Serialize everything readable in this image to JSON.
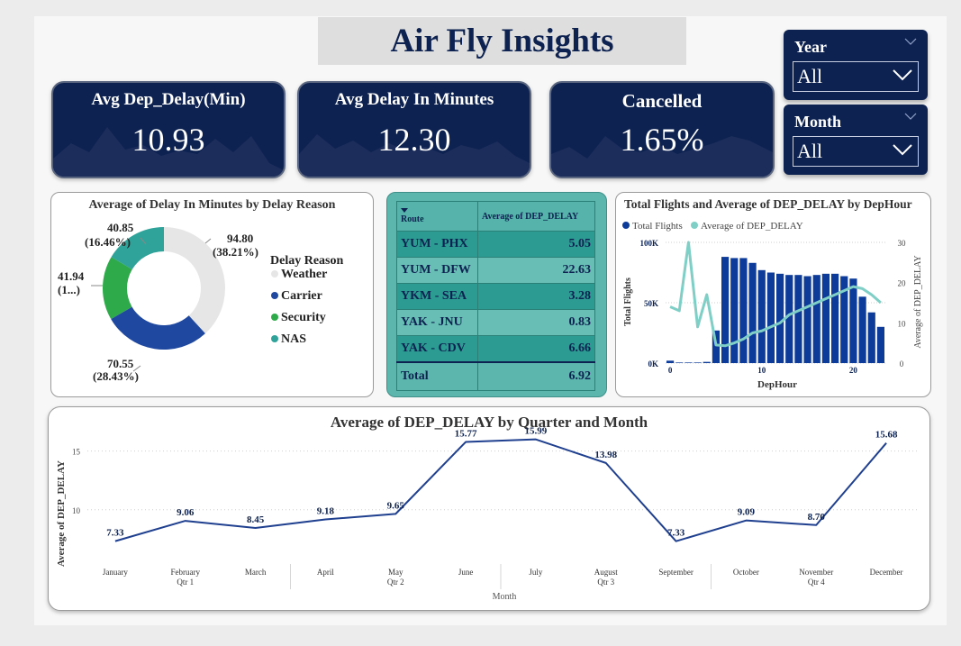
{
  "header": {
    "title": "Air Fly Insights"
  },
  "kpis": [
    {
      "label": "Avg Dep_Delay(Min)",
      "value": "10.93"
    },
    {
      "label": "Avg Delay In Minutes",
      "value": "12.30"
    },
    {
      "label": "Cancelled",
      "value": "1.65%"
    }
  ],
  "slicers": {
    "year": {
      "title": "Year",
      "value": "All"
    },
    "month": {
      "title": "Month",
      "value": "All"
    }
  },
  "colors": {
    "navy": "#0d2250",
    "teal": "#5cb6ae",
    "weather": "#e6e6e6",
    "carrier": "#1f48a0",
    "security": "#2eaa4a",
    "nas": "#2fa39a",
    "line_teal": "#7fcfc6"
  },
  "chart_data": [
    {
      "type": "pie",
      "title": "Average of Delay In Minutes by Delay Reason",
      "legend_title": "Delay Reason",
      "legend_position": "right",
      "categories": [
        "Weather",
        "Carrier",
        "Security",
        "NAS"
      ],
      "values": [
        94.8,
        70.55,
        41.94,
        40.85
      ],
      "data_labels": [
        {
          "value": "94.80",
          "percent": "(38.21%)"
        },
        {
          "value": "70.55",
          "percent": "(28.43%)"
        },
        {
          "value": "41.94",
          "percent": "(1...)"
        },
        {
          "value": "40.85",
          "percent": "(16.46%)"
        }
      ]
    },
    {
      "type": "table",
      "columns": [
        "Route",
        "Average of DEP_DELAY"
      ],
      "rows": [
        [
          "YUM - PHX",
          "5.05"
        ],
        [
          "YUM - DFW",
          "22.63"
        ],
        [
          "YKM - SEA",
          "3.28"
        ],
        [
          "YAK - JNU",
          "0.83"
        ],
        [
          "YAK - CDV",
          "6.66"
        ]
      ],
      "total": [
        "Total",
        "6.92"
      ]
    },
    {
      "type": "bar",
      "title": "Total Flights and Average of DEP_DELAY by DepHour",
      "xlabel": "DepHour",
      "ylabel": "Total Flights",
      "ylabel_right": "Average of DEP_DELAY",
      "legend_position": "top-left",
      "x": [
        0,
        1,
        2,
        3,
        4,
        5,
        6,
        7,
        8,
        9,
        10,
        11,
        12,
        13,
        14,
        15,
        16,
        17,
        18,
        19,
        20,
        21,
        22,
        23
      ],
      "x_ticks": [
        "0",
        "10",
        "20"
      ],
      "y_ticks": [
        "0K",
        "50K",
        "100K"
      ],
      "y_right_ticks": [
        "0",
        "10",
        "20",
        "30"
      ],
      "ylim": [
        0,
        100
      ],
      "ylim_right": [
        0,
        30
      ],
      "series": [
        {
          "name": "Total Flights",
          "kind": "bar",
          "values": [
            2,
            0.5,
            0.5,
            0.5,
            1,
            27,
            88,
            87,
            87,
            83,
            77,
            75,
            74,
            73,
            73,
            72,
            73,
            74,
            74,
            72,
            70,
            55,
            42,
            30
          ]
        },
        {
          "name": "Average of DEP_DELAY",
          "kind": "line",
          "values": [
            14,
            13,
            30,
            9,
            17,
            4.5,
            4.3,
            5,
            6,
            7.5,
            8,
            9,
            10,
            12,
            13,
            14,
            15,
            16,
            17,
            18,
            19,
            18.5,
            17,
            15
          ]
        }
      ]
    },
    {
      "type": "line",
      "title": "Average of DEP_DELAY by Quarter and Month",
      "xlabel": "Month",
      "ylabel": "Average of DEP_DELAY",
      "categories": [
        "January",
        "February",
        "March",
        "April",
        "May",
        "June",
        "July",
        "August",
        "September",
        "October",
        "November",
        "December"
      ],
      "quarters": [
        "Qtr 1",
        "Qtr 2",
        "Qtr 3",
        "Qtr 4"
      ],
      "values": [
        7.33,
        9.06,
        8.45,
        9.18,
        9.65,
        15.77,
        15.99,
        13.98,
        7.33,
        9.09,
        8.7,
        15.68
      ],
      "y_ticks": [
        "10",
        "15"
      ],
      "ylim": [
        6,
        16.5
      ],
      "grid": true
    }
  ]
}
